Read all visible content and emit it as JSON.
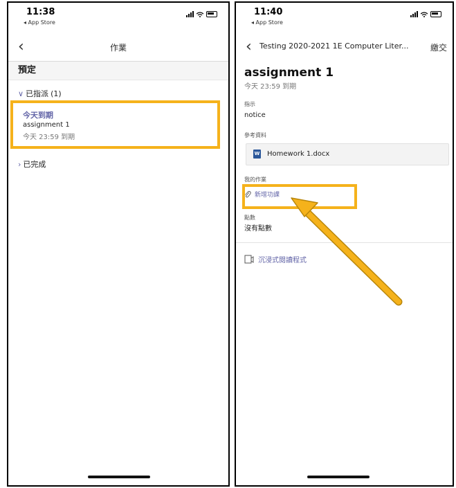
{
  "left": {
    "status": {
      "time": "11:38",
      "back_app": "◂ App Store"
    },
    "nav": {
      "back_icon": "chevron-left-icon",
      "title": "作業"
    },
    "section_header": "預定",
    "assigned_group": {
      "label": "已指派",
      "count": "(1)"
    },
    "assignment": {
      "due_label": "今天到期",
      "name": "assignment 1",
      "due_time": "今天 23:59 到期"
    },
    "completed_group": {
      "label": "已完成"
    }
  },
  "right": {
    "status": {
      "time": "11:40",
      "back_app": "◂ App Store"
    },
    "nav": {
      "back_icon": "chevron-left-icon",
      "title": "Testing 2020-2021 1E Computer Liter...",
      "submit": "繳交"
    },
    "assignment": {
      "title": "assignment 1",
      "due": "今天 23:59 到期",
      "instructions_label": "指示",
      "instructions_value": "notice",
      "references_label": "參考資料",
      "file_name": "Homework 1.docx",
      "my_work_label": "我的作業",
      "add_work": "新增功課",
      "points_label": "點數",
      "points_value": "沒有點數",
      "immersive_reader": "沉浸式閱讀程式"
    }
  },
  "colors": {
    "accent": "#6264a7",
    "highlight": "#f5b21b"
  }
}
